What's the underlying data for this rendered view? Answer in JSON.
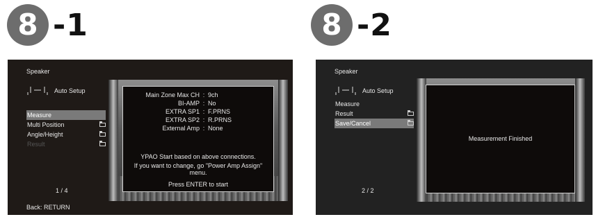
{
  "step1": {
    "number": "8",
    "suffix": "-1"
  },
  "step2": {
    "number": "8",
    "suffix": "-2"
  },
  "screen1": {
    "title": "Speaker",
    "auto_setup": "Auto Setup",
    "menu": [
      {
        "label": "Measure",
        "selected": true,
        "disabled": false,
        "folder": false
      },
      {
        "label": "Multi Position",
        "selected": false,
        "disabled": false,
        "folder": true
      },
      {
        "label": "Angle/Height",
        "selected": false,
        "disabled": false,
        "folder": true
      },
      {
        "label": "Result",
        "selected": false,
        "disabled": true,
        "folder": true
      }
    ],
    "page": "1 / 4",
    "back": "Back: RETURN",
    "dialog": {
      "rows": [
        {
          "key": "Main Zone Max CH",
          "value": "9ch"
        },
        {
          "key": "BI-AMP",
          "value": "No"
        },
        {
          "key": "EXTRA SP1",
          "value": "F.PRNS"
        },
        {
          "key": "EXTRA SP2",
          "value": "R.PRNS"
        },
        {
          "key": "External Amp",
          "value": "None"
        }
      ],
      "msg1": "YPAO Start based on above connections.",
      "msg2": "If you want to change, go \"Power Amp Assign\"",
      "msg3": "menu.",
      "msg4": "Press ENTER to start"
    }
  },
  "screen2": {
    "title": "Speaker",
    "auto_setup": "Auto Setup",
    "menu": [
      {
        "label": "Measure",
        "selected": false,
        "disabled": false,
        "folder": false
      },
      {
        "label": "Result",
        "selected": false,
        "disabled": false,
        "folder": true
      },
      {
        "label": "Save/Cancel",
        "selected": true,
        "disabled": false,
        "folder": true
      }
    ],
    "page": "2 / 2",
    "dialog": {
      "message": "Measurement Finished"
    }
  }
}
